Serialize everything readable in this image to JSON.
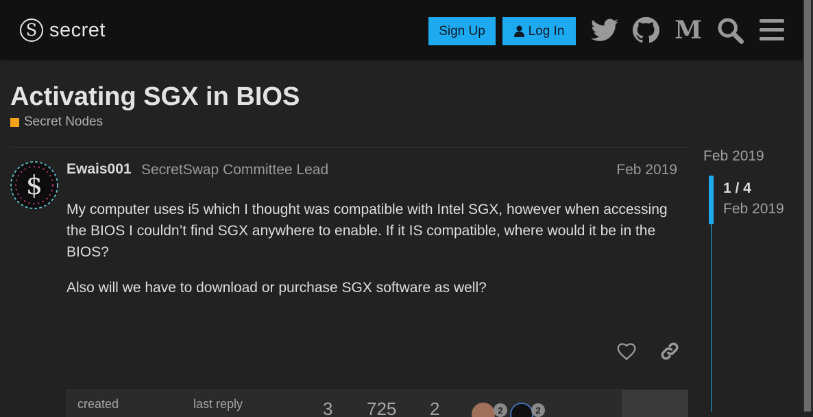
{
  "header": {
    "logo_text": "secret",
    "signup_label": "Sign Up",
    "login_label": "Log In",
    "icons": [
      "twitter-icon",
      "github-icon",
      "medium-icon",
      "search-icon",
      "hamburger-menu-icon"
    ]
  },
  "topic": {
    "title": "Activating SGX in BIOS",
    "category": "Secret Nodes",
    "category_color": "#f5a31a"
  },
  "post": {
    "username": "Ewais001",
    "user_title": "SecretSwap Committee Lead",
    "date": "Feb 2019",
    "paragraphs": [
      "My computer uses i5 which I thought was compatible with Intel SGX, however when accessing the BIOS I couldn’t find SGX anywhere to enable. If it IS compatible, where would it be in the BIOS?",
      "Also will we have to download or purchase SGX software as well?"
    ]
  },
  "topic_map": {
    "created_label": "created",
    "last_reply_label": "last reply",
    "replies": "3",
    "views": "725",
    "users": "2",
    "badge_1": "2",
    "badge_2": "2"
  },
  "timeline": {
    "top_date": "Feb 2019",
    "position": "1 / 4",
    "current_date": "Feb 2019"
  },
  "colors": {
    "accent": "#1eaaf1",
    "background": "#222222",
    "header_bg": "#111111"
  }
}
